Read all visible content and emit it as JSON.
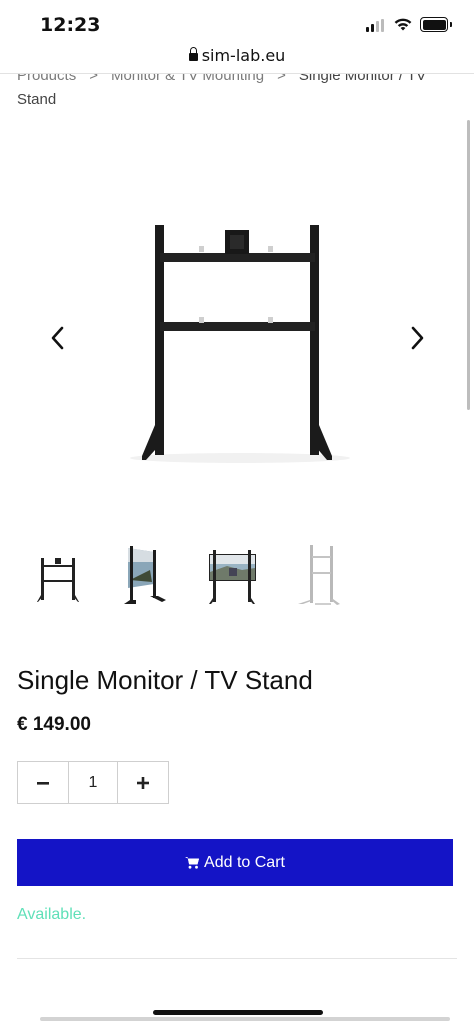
{
  "status_bar": {
    "time": "12:23"
  },
  "browser": {
    "url": "sim-lab.eu"
  },
  "breadcrumb": {
    "items": [
      "Products",
      "Monitor & TV Mounting"
    ],
    "separator": ">",
    "current": "Single Monitor / TV Stand"
  },
  "gallery": {
    "main_image": "single-monitor-stand-black",
    "prev_icon": "chevron-left-icon",
    "next_icon": "chevron-right-icon",
    "thumbnails": [
      "stand-black-front",
      "stand-with-monitor-angle",
      "stand-with-monitor-front",
      "stand-silver-angle"
    ]
  },
  "product": {
    "title": "Single Monitor / TV Stand",
    "price": "€ 149.00",
    "quantity": "1",
    "decrease_label": "−",
    "increase_label": "+",
    "add_to_cart_label": "Add to Cart",
    "availability": "Available."
  },
  "colors": {
    "cart_button": "#1414c6",
    "available_text": "#5fe0b8"
  }
}
